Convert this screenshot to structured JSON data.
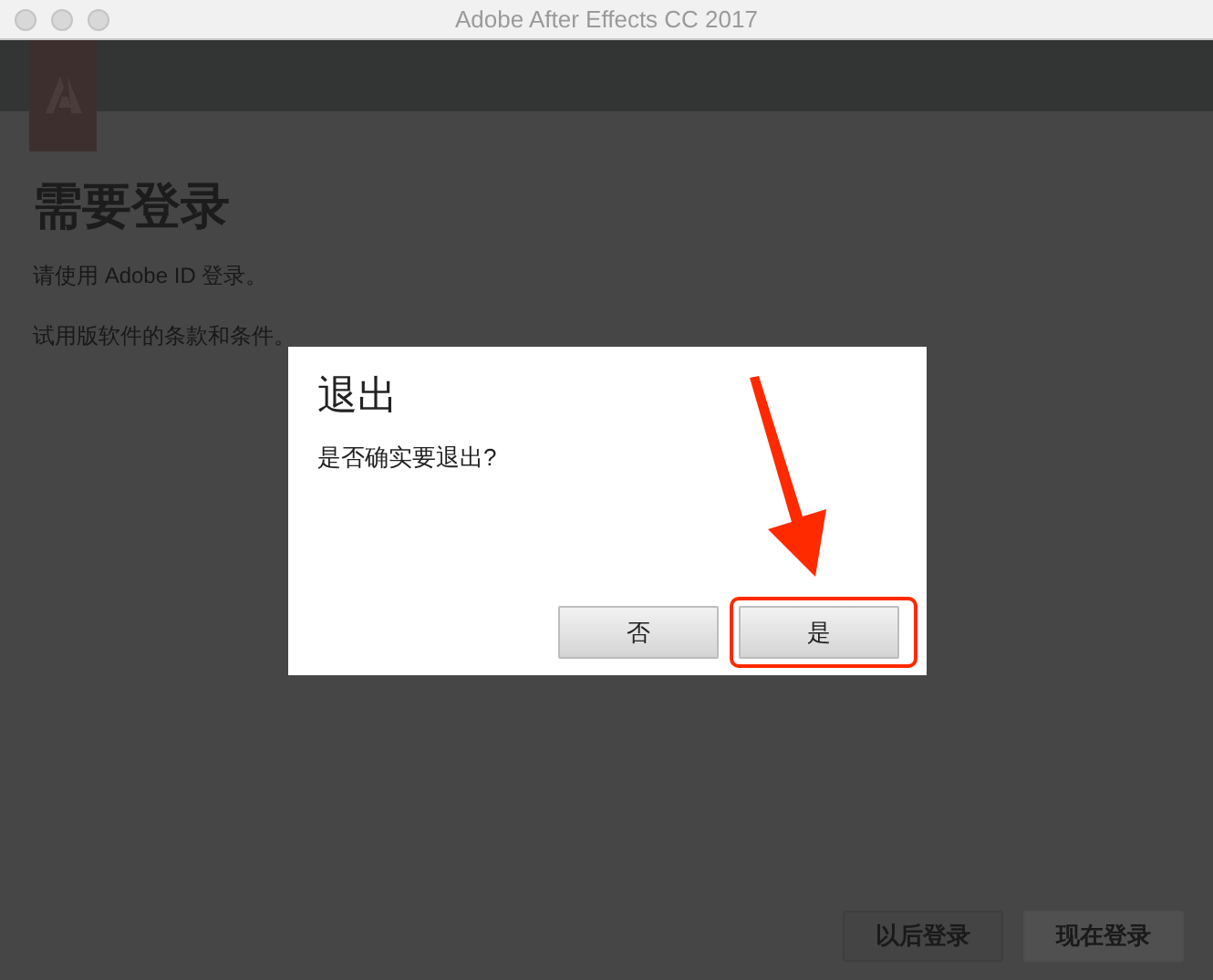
{
  "window": {
    "title": "Adobe After Effects CC 2017"
  },
  "background": {
    "heading": "需要登录",
    "lines": [
      "请使用 Adobe ID 登录。",
      "试用版软件的条款和条件。"
    ],
    "buttons": [
      {
        "label": "以后登录",
        "kind": "secondary"
      },
      {
        "label": "现在登录",
        "kind": "primary"
      }
    ]
  },
  "dialog": {
    "title": "退出",
    "message": "是否确实要退出?",
    "buttons": [
      {
        "label": "否",
        "highlighted": false
      },
      {
        "label": "是",
        "highlighted": true
      }
    ]
  }
}
